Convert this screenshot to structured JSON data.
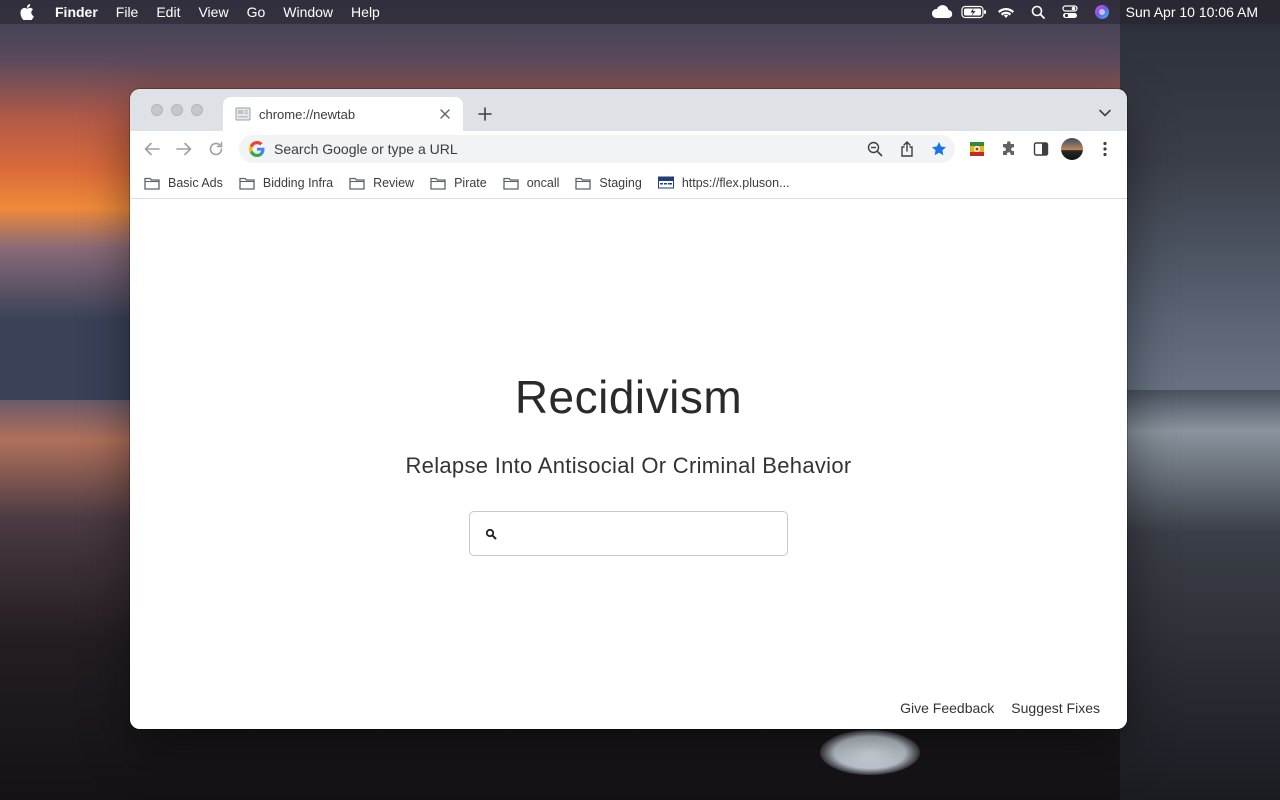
{
  "menubar": {
    "app": "Finder",
    "items": [
      "File",
      "Edit",
      "View",
      "Go",
      "Window",
      "Help"
    ],
    "clock": "Sun Apr 10  10:06 AM"
  },
  "browser": {
    "tab": {
      "title": "chrome://newtab"
    },
    "omnibox": {
      "placeholder": "Search Google or type a URL"
    },
    "bookmarks": [
      {
        "label": "Basic Ads",
        "icon": "folder-icon"
      },
      {
        "label": "Bidding Infra",
        "icon": "folder-icon"
      },
      {
        "label": "Review",
        "icon": "folder-icon"
      },
      {
        "label": "Pirate",
        "icon": "folder-icon"
      },
      {
        "label": "oncall",
        "icon": "folder-icon"
      },
      {
        "label": "Staging",
        "icon": "folder-icon"
      },
      {
        "label": "https://flex.pluson...",
        "icon": "site-favicon"
      }
    ]
  },
  "page": {
    "title": "Recidivism",
    "subtitle": "Relapse Into Antisocial Or Criminal Behavior",
    "search_value": "",
    "footer": {
      "feedback": "Give Feedback",
      "fixes": "Suggest Fixes"
    }
  },
  "colors": {
    "bookmark_star": "#1a73e8",
    "tabstrip": "#dee1e6",
    "omnibox": "#f1f3f4"
  }
}
